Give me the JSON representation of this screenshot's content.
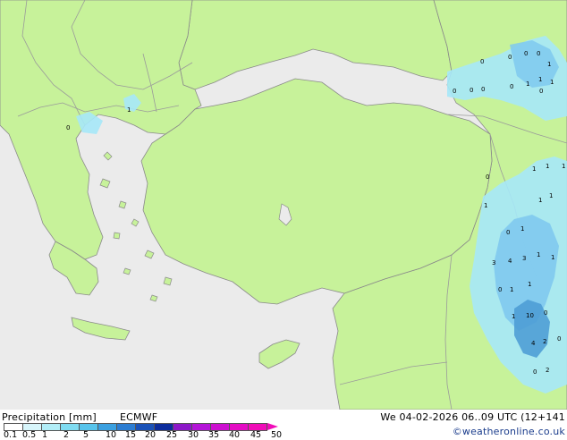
{
  "map": {
    "sea_color": "#ebebeb",
    "land_color": "#c7f29a",
    "border_color": "#9a9a9a",
    "coast_color": "#8a8a8a",
    "precip_light": "#a6e8f8",
    "precip_mid": "#7fc9ee",
    "precip_heavy": "#4a9ad4",
    "precip_labels": [
      "0",
      "0",
      "0",
      "0",
      "1",
      "0",
      "0",
      "0",
      "1",
      "1",
      "1",
      "0",
      "0",
      "1",
      "1",
      "1",
      "1",
      "1",
      "0",
      "1",
      "3",
      "4",
      "3",
      "1",
      "1",
      "0",
      "1",
      "1",
      "1",
      "10",
      "0",
      "4",
      "2",
      "0",
      "0",
      "2",
      "1",
      "0",
      "0",
      "1"
    ]
  },
  "footer": {
    "legend_title": "Precipitation [mm]",
    "model": "ECMWF",
    "run_info": "We 04-02-2026 06..09 UTC (12+141",
    "credit": "©weatheronline.co.uk"
  },
  "legend": {
    "labels": [
      "0.1",
      "0.5",
      "1",
      "2",
      "5",
      "10",
      "15",
      "20",
      "25",
      "30",
      "35",
      "40",
      "45",
      "50"
    ],
    "colors": [
      "#ffffff",
      "#d8f6fb",
      "#b2eef8",
      "#7fdcf2",
      "#57c4ec",
      "#3ba0e0",
      "#2c7dd2",
      "#1a52b8",
      "#0c2c9c",
      "#8c18c8",
      "#b414d8",
      "#cc10d0",
      "#e40cc4",
      "#f00cb8"
    ]
  }
}
